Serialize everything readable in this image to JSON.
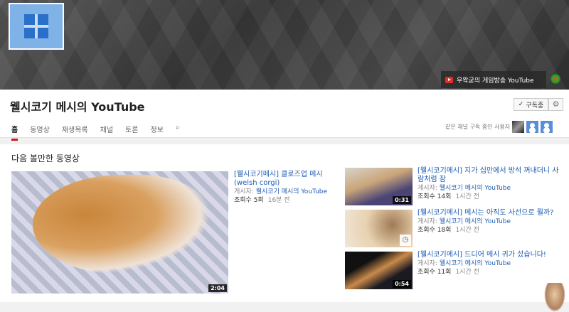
{
  "banner": {
    "link_label": "우왁굳의 게임방송 YouTube"
  },
  "channel": {
    "title": "웰시코기 메시의 YouTube",
    "subscribe_label": "구독중",
    "subscribe_check": "✓",
    "gear": "⚙"
  },
  "tabs": [
    {
      "label": "홈"
    },
    {
      "label": "동영상"
    },
    {
      "label": "재생목록"
    },
    {
      "label": "채널"
    },
    {
      "label": "토론"
    },
    {
      "label": "정보"
    }
  ],
  "search_icon": "⌕",
  "subscribers_label": "같은 채널 구독 중인 사용자",
  "section_title": "다음 볼만한 동영상",
  "featured": {
    "title": "[웰시코기메시] 클로즈업 메시 (welsh corgi)",
    "by_label": "게시자:",
    "channel": "웰시코기 메시의 YouTube",
    "views": "조회수 5회",
    "ago": "16분 전",
    "duration": "2:04"
  },
  "videos": [
    {
      "title": "[웰시코기메시] 지가 십만에서 방석 꺼내더니 사람처럼 잠",
      "by_label": "게시자:",
      "channel": "웰시코기 메시의 YouTube",
      "views": "조회수 14회",
      "ago": "1시간 전",
      "duration": "0:31"
    },
    {
      "title": "[웰시코기메시] 메시는 아직도 사선으로 뭘까?",
      "by_label": "게시자:",
      "channel": "웰시코기 메시의 YouTube",
      "views": "조회수 18회",
      "ago": "1시간 전",
      "duration": ""
    },
    {
      "title": "[웰시코기메시] 드디어 메시 귀가 섰습니다!",
      "by_label": "게시자:",
      "channel": "웰시코기 메시의 YouTube",
      "views": "조회수 11회",
      "ago": "1시간 전",
      "duration": "0:54"
    }
  ]
}
